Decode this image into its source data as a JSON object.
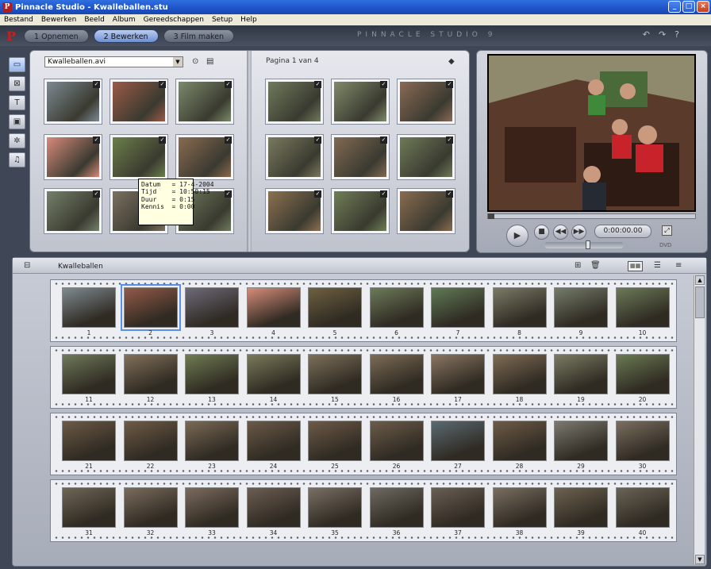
{
  "window": {
    "title": "Pinnacle Studio - Kwalleballen.stu",
    "minimize": "_",
    "maximize": "□",
    "close": "×"
  },
  "menu": [
    "Bestand",
    "Bewerken",
    "Beeld",
    "Album",
    "Gereedschappen",
    "Setup",
    "Help"
  ],
  "tabs": [
    {
      "label": "1 Opnemen",
      "active": false
    },
    {
      "label": "2 Bewerken",
      "active": true
    },
    {
      "label": "3 Film maken",
      "active": false
    }
  ],
  "brand": "PINNACLE STUDIO 9",
  "top_icons": [
    "undo-icon",
    "redo-icon",
    "help-icon"
  ],
  "album": {
    "dropdown": "Kwalleballen.avi",
    "page_info": "Pagina 1 van 4",
    "tooltip": "Datum   = 17-4-2004\nTijd    = 10:50:15\nDuur    = 0:15\nKennis  = 0:00",
    "left_thumbs": [
      "#7d8a92",
      "#9b5a47",
      "#7a8a6a",
      "#d88a7a",
      "#6b7f4a",
      "#8a6a4f",
      "#74806a",
      "#7b7060",
      "#6f7a5c"
    ],
    "right_thumbs": [
      "#6f7b5c",
      "#7f8a6a",
      "#8a6a55",
      "#7a7a5f",
      "#826a52",
      "#6e7a58",
      "#8c7150",
      "#6f7e56",
      "#8a6c50"
    ]
  },
  "player": {
    "timecode": "0:00:00.00",
    "dvd_label": "DVD"
  },
  "storyboard": {
    "title": "Kwalleballen",
    "rows": [
      {
        "numbers": [
          "1",
          "2",
          "3",
          "4",
          "5",
          "6",
          "7",
          "8",
          "9",
          "10"
        ],
        "colors": [
          "#7e8a91",
          "#935a48",
          "#6d6a7a",
          "#d68c7a",
          "#6e6040",
          "#6d7b5a",
          "#5f7a56",
          "#7b7a66",
          "#747c6a",
          "#6b7a58"
        ]
      },
      {
        "numbers": [
          "11",
          "12",
          "13",
          "14",
          "15",
          "16",
          "17",
          "18",
          "19",
          "20"
        ],
        "colors": [
          "#6f7a5a",
          "#82705a",
          "#6f7c52",
          "#7a7a5a",
          "#7d705a",
          "#7c6c55",
          "#8a7562",
          "#7f6b55",
          "#7a7b62",
          "#6a7a52"
        ]
      },
      {
        "numbers": [
          "21",
          "22",
          "23",
          "24",
          "25",
          "26",
          "27",
          "28",
          "29",
          "30"
        ],
        "colors": [
          "#6c5a46",
          "#6f5b47",
          "#7a6a56",
          "#6a5a48",
          "#6e5a48",
          "#6c5c4a",
          "#5a6a72",
          "#6e5b47",
          "#7c7a70",
          "#7a6e60"
        ]
      },
      {
        "numbers": [
          "31",
          "32",
          "33",
          "34",
          "35",
          "36",
          "37",
          "38",
          "39",
          "40"
        ],
        "colors": [
          "#6f6656",
          "#7a6c5c",
          "#7c6b5e",
          "#6c5d52",
          "#7a6f64",
          "#6f6a60",
          "#6a5e54",
          "#7a6e60",
          "#6e6250",
          "#6a6355"
        ]
      }
    ],
    "selected_clip": "2"
  }
}
